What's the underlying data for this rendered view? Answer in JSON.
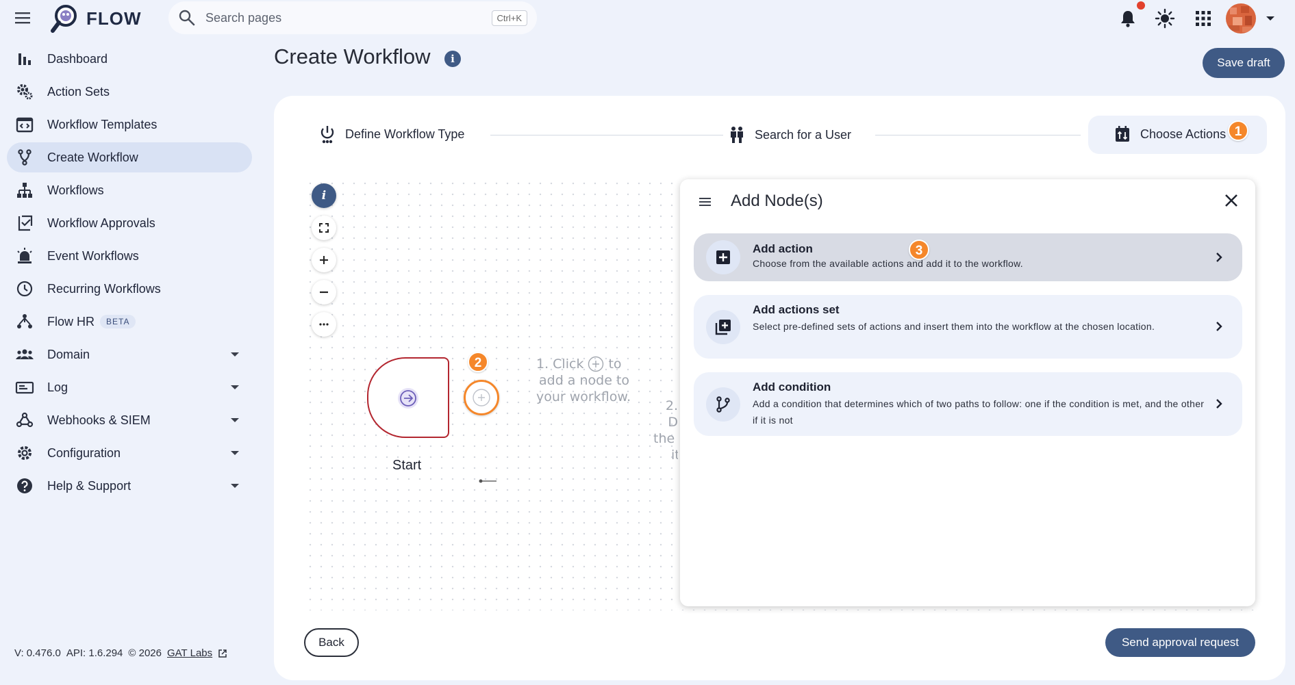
{
  "app": {
    "name": "FLOW"
  },
  "search": {
    "placeholder": "Search pages",
    "shortcut": "Ctrl+K"
  },
  "topbar_icons": [
    "bell-icon",
    "brightness-icon",
    "apps-grid-icon",
    "avatar"
  ],
  "sidebar": {
    "items": [
      {
        "label": "Dashboard",
        "icon": "bar-chart-icon"
      },
      {
        "label": "Action Sets",
        "icon": "gear-pair-icon"
      },
      {
        "label": "Workflow Templates",
        "icon": "code-window-icon"
      },
      {
        "label": "Create Workflow",
        "icon": "fork-icon",
        "active": true
      },
      {
        "label": "Workflows",
        "icon": "org-chart-icon"
      },
      {
        "label": "Workflow Approvals",
        "icon": "checklist-icon"
      },
      {
        "label": "Event Workflows",
        "icon": "alarm-light-icon"
      },
      {
        "label": "Recurring Workflows",
        "icon": "clock-icon"
      },
      {
        "label": "Flow HR",
        "icon": "people-network-icon",
        "badge": "BETA"
      },
      {
        "label": "Domain",
        "icon": "groups-icon",
        "expandable": true
      },
      {
        "label": "Log",
        "icon": "log-card-icon",
        "expandable": true
      },
      {
        "label": "Webhooks & SIEM",
        "icon": "webhook-icon",
        "expandable": true
      },
      {
        "label": "Configuration",
        "icon": "settings-icon",
        "expandable": true
      },
      {
        "label": "Help & Support",
        "icon": "help-circle-icon",
        "expandable": true
      }
    ]
  },
  "footer": {
    "version": "V: 0.476.0",
    "api": "API: 1.6.294",
    "copyright": "© 2026",
    "company": "GAT Labs"
  },
  "page": {
    "title": "Create Workflow",
    "info_glyph": "i",
    "save_label": "Save draft"
  },
  "stepper": {
    "steps": [
      {
        "label": "Define Workflow Type",
        "icon": "power-icon"
      },
      {
        "label": "Search for a User",
        "icon": "people-icon"
      },
      {
        "label": "Choose Actions",
        "icon": "swap-calendar-icon",
        "active": true
      }
    ]
  },
  "badges": {
    "one": "1",
    "two": "2",
    "three": "3"
  },
  "canvas": {
    "start_label": "Start",
    "hint1": [
      "1. Click",
      "to",
      "add a node to",
      "your workflow."
    ],
    "hint2": [
      "2. D",
      "the",
      "it"
    ]
  },
  "panel": {
    "title": "Add Node(s)",
    "options": [
      {
        "title": "Add action",
        "desc": "Choose from the available actions and add it to the workflow.",
        "icon": "add-box-icon"
      },
      {
        "title": "Add actions set",
        "desc": "Select pre-defined sets of actions and insert them into the workflow at the chosen location.",
        "icon": "library-add-icon"
      },
      {
        "title": "Add condition",
        "desc": "Add a condition that determines which of two paths to follow: one if the condition is met, and the other if it is not",
        "icon": "branch-icon"
      }
    ]
  },
  "actions": {
    "back": "Back",
    "send": "Send approval request"
  },
  "colors": {
    "primary": "#3f5a85",
    "accent": "#f5872a",
    "start_border": "#b3262f",
    "background": "#eef2fb"
  }
}
